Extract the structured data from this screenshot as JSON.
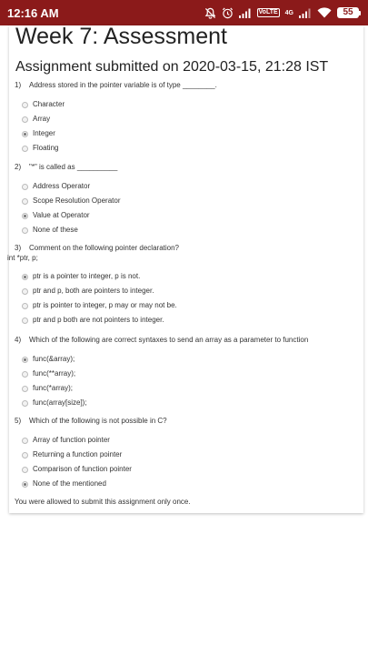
{
  "status_bar": {
    "time": "12:16 AM",
    "network_label": "4G",
    "volte_label": "VoLTE",
    "battery": "55",
    "icons": [
      "mute-icon",
      "alarm-icon",
      "signal-icon",
      "volte-icon",
      "4g-signal-icon",
      "wifi-icon",
      "battery-icon"
    ]
  },
  "page": {
    "title": "Week 7: Assessment",
    "submitted": "Assignment submitted on 2020-03-15, 21:28 IST",
    "footer": "You were allowed to submit this assignment only once."
  },
  "questions": [
    {
      "number": "1)",
      "text": "Address stored in the pointer variable is of type ________.",
      "code": "",
      "options": [
        {
          "label": "Character",
          "selected": false
        },
        {
          "label": "Array",
          "selected": false
        },
        {
          "label": "Integer",
          "selected": true
        },
        {
          "label": "Floating",
          "selected": false
        }
      ]
    },
    {
      "number": "2)",
      "text": "\"*\" is called as __________",
      "code": "",
      "options": [
        {
          "label": "Address Operator",
          "selected": false
        },
        {
          "label": "Scope Resolution Operator",
          "selected": false
        },
        {
          "label": "Value at Operator",
          "selected": true
        },
        {
          "label": "None of these",
          "selected": false
        }
      ]
    },
    {
      "number": "3)",
      "text": "Comment on the following pointer declaration?",
      "code": "int *ptr, p;",
      "options": [
        {
          "label": "ptr is a pointer to integer, p is not.",
          "selected": true
        },
        {
          "label": "ptr and p, both are pointers to integer.",
          "selected": false
        },
        {
          "label": "ptr is pointer to integer, p may or may not be.",
          "selected": false
        },
        {
          "label": "ptr and p both are not pointers to integer.",
          "selected": false
        }
      ]
    },
    {
      "number": "4)",
      "text": "Which of the following are correct syntaxes to send an array as a parameter to function",
      "code": "",
      "options": [
        {
          "label": "func(&array);",
          "selected": true
        },
        {
          "label": "func(**array);",
          "selected": false
        },
        {
          "label": "func(*array);",
          "selected": false
        },
        {
          "label": "func(array[size]);",
          "selected": false
        }
      ]
    },
    {
      "number": "5)",
      "text": "Which of the following is not possible in C?",
      "code": "",
      "options": [
        {
          "label": "Array of function pointer",
          "selected": false
        },
        {
          "label": "Returning a function pointer",
          "selected": false
        },
        {
          "label": "Comparison of function pointer",
          "selected": false
        },
        {
          "label": "None of the mentioned",
          "selected": true
        }
      ]
    }
  ]
}
